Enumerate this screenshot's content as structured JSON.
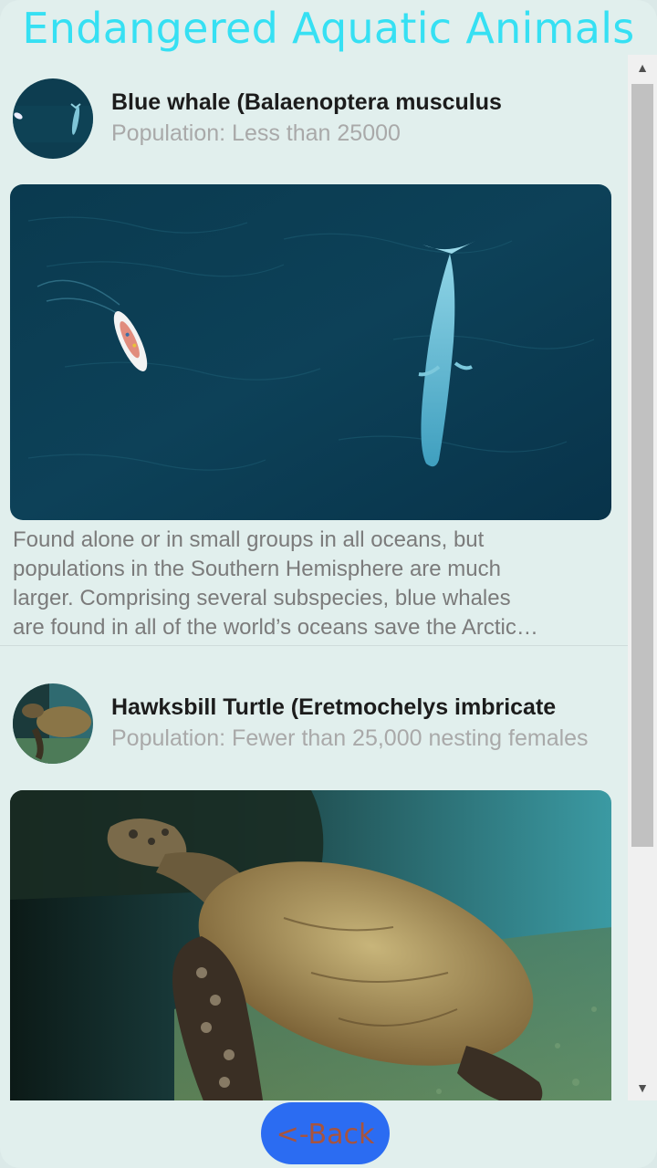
{
  "app": {
    "title": "Endangered Aquatic Animals"
  },
  "animals": [
    {
      "name": "Blue whale (Balaenoptera musculus",
      "population": "Population: Less than 25000",
      "description_lines": [
        "Found alone or in small groups in all oceans, but",
        "populations in the Southern Hemisphere are much",
        "larger. Comprising several subspecies, blue whales",
        "are found in all of the world’s oceans save the Arctic…"
      ]
    },
    {
      "name": "Hawksbill Turtle (Eretmochelys imbricate",
      "population": "Population: Fewer than 25,000 nesting females"
    }
  ],
  "footer": {
    "back_label": "<-Back"
  },
  "scrollbar": {
    "up_glyph": "▲",
    "down_glyph": "▼"
  },
  "colors": {
    "title": "#36e0f3",
    "back_button": "#2b6cf2",
    "background": "#e1efed"
  }
}
